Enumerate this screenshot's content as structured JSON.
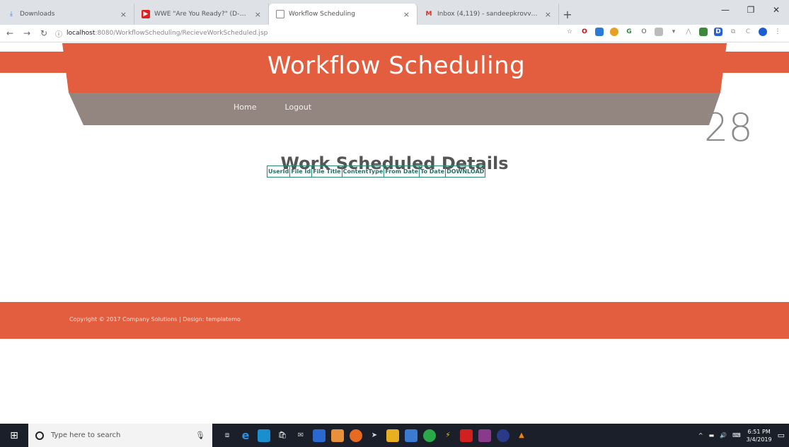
{
  "browser": {
    "tabs": [
      {
        "title": "Downloads",
        "icon": "download-icon",
        "active": false
      },
      {
        "title": "WWE \"Are You Ready?\" (D-Gen...",
        "icon": "youtube-icon",
        "active": false
      },
      {
        "title": "Workflow Scheduling",
        "icon": "page-icon",
        "active": true
      },
      {
        "title": "Inbox (4,119) - sandeepkrovvidi...",
        "icon": "gmail-icon",
        "active": false
      }
    ],
    "url_host": "localhost",
    "url_path": ":8080/WorkflowScheduling/RecieveWorkScheduled.jsp"
  },
  "site": {
    "title": "Workflow Scheduling",
    "nav": [
      "Home",
      "Logout"
    ],
    "big_number": "28"
  },
  "main": {
    "heading": "Work Scheduled Details",
    "table_headers": [
      "UserId",
      "File Id",
      "File Title",
      "ContentType",
      "From Date",
      "To Date",
      "DOWNLOAD"
    ]
  },
  "footer": {
    "copyright": "Copyright © 2017 Company Solutions | Design: templatemo"
  },
  "taskbar": {
    "search_placeholder": "Type here to search",
    "time": "6:51 PM",
    "date": "3/4/2019"
  },
  "colors": {
    "brand": "#e25e3e",
    "nav_bar": "#938680",
    "table_border": "#2a8a78"
  }
}
